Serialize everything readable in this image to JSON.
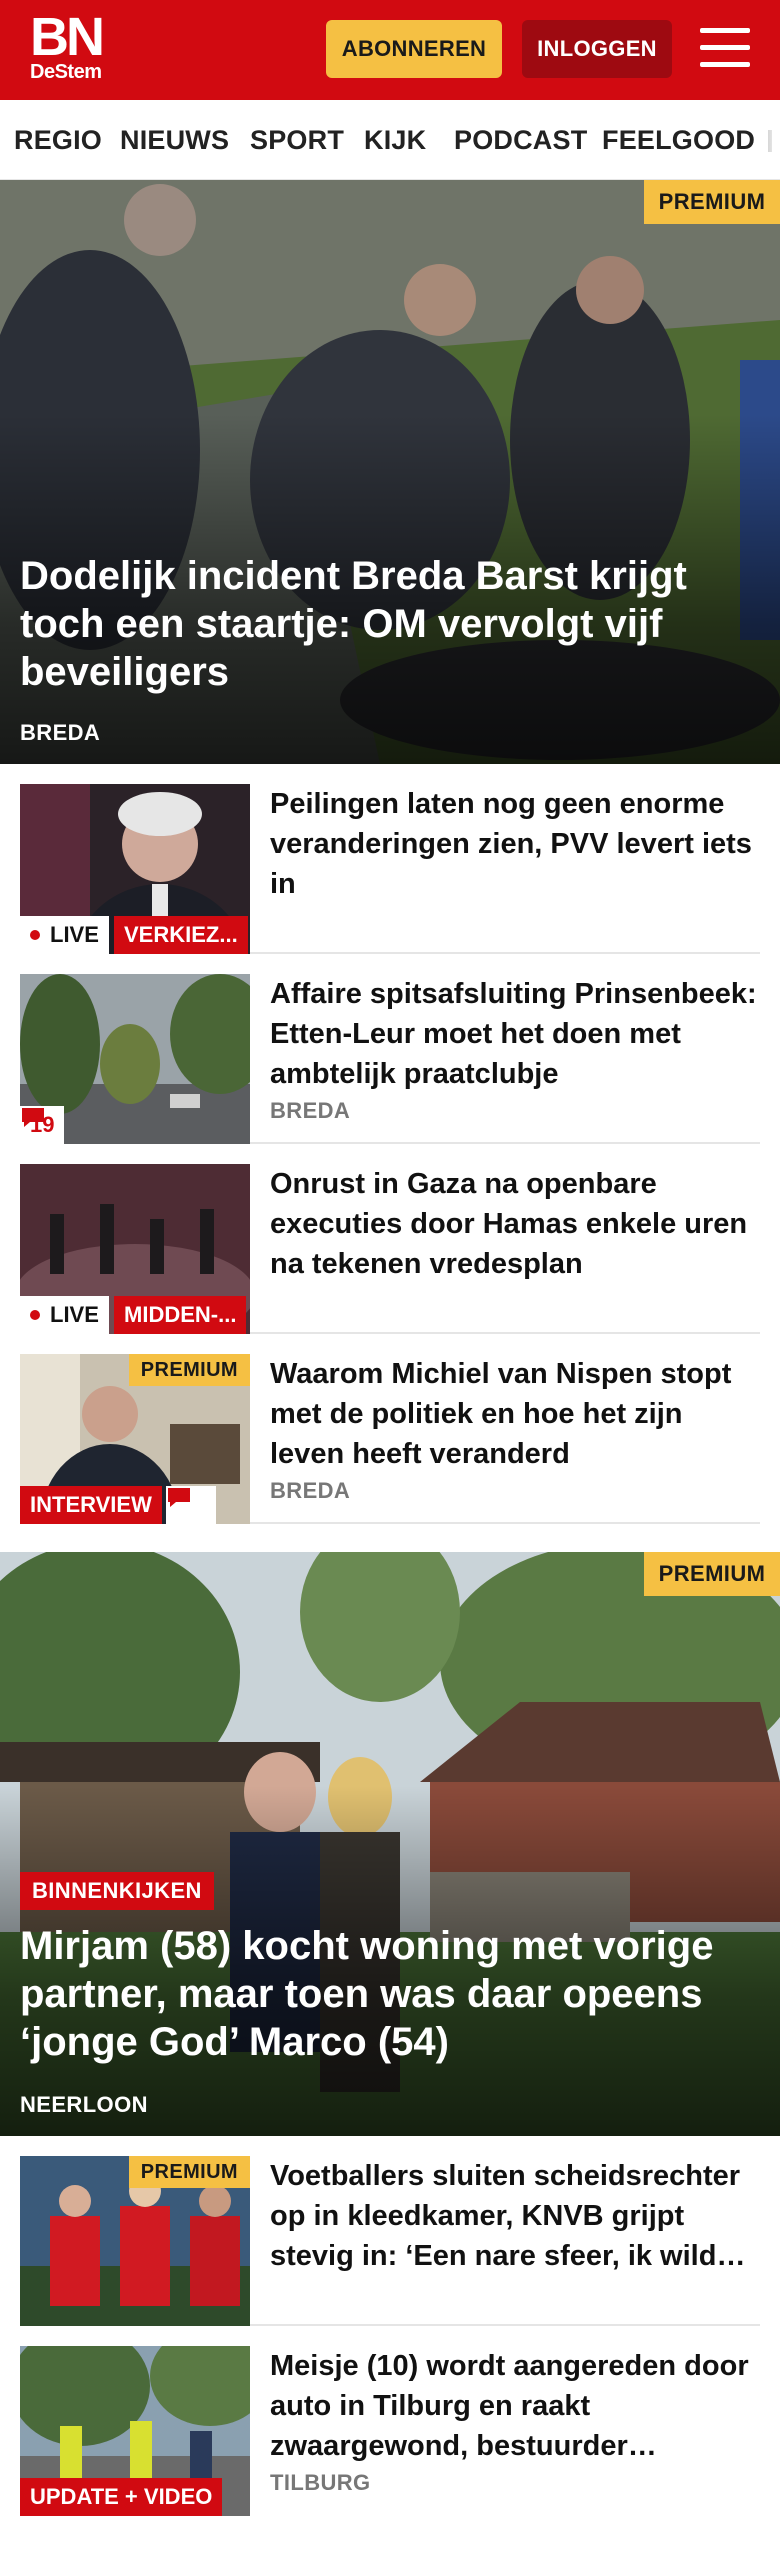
{
  "header": {
    "logo_main": "BN",
    "logo_sub": "DeStem",
    "subscribe_label": "ABONNEREN",
    "login_label": "INLOGGEN",
    "menu_icon": "hamburger-menu-icon"
  },
  "nav": {
    "items": [
      "REGIO",
      "NIEUWS",
      "SPORT",
      "KIJK",
      "PODCAST",
      "FEELGOOD"
    ]
  },
  "hero1": {
    "premium": "PREMIUM",
    "title": "Dodelijk incident Breda Barst krijgt toch een staartje: OM vervolgt vijf beveiligers",
    "location": "BREDA"
  },
  "articles": [
    {
      "title": "Peilingen laten nog geen enorme veranderingen zien, PVV levert iets in",
      "live": "LIVE",
      "tag": "VERKIEZ..."
    },
    {
      "title": "Affaire spitsafsluiting Prinsen­beek: Etten-Leur moet het doen met ambtelijk praatclubje",
      "location": "BREDA",
      "comments": "19"
    },
    {
      "title": "Onrust in Gaza na openbare executies door Hamas enkele uren na tekenen vredesplan",
      "live": "LIVE",
      "tag": "MIDDEN-..."
    },
    {
      "title": "Waarom Michiel van Nispen stopt met de politiek en hoe het zijn leven heeft veranderd",
      "location": "BREDA",
      "premium": "PREMIUM",
      "tag": "INTERVIEW"
    }
  ],
  "hero2": {
    "premium": "PREMIUM",
    "label": "BINNENKIJKEN",
    "title": "Mirjam (58) kocht woning met vorige partner, maar toen was daar opeens ‘jonge God’ Marco (54)",
    "location": "NEERLOON"
  },
  "articles2": [
    {
      "title": "Voetballers sluiten scheidsrech­ter op in kleedkamer, KNVB grijpt stevig in: ‘Een nare sfeer, ik wild…",
      "premium": "PREMIUM"
    },
    {
      "title": "Meisje (10) wordt aangereden door auto in Tilburg en raakt zwaargewond, bestuurder…",
      "location": "TILBURG",
      "tag": "UPDATE + VIDEO"
    }
  ],
  "colors": {
    "brand_red": "#d10a11",
    "premium_yellow": "#f5c043",
    "login_dark_red": "#9e0a11"
  }
}
